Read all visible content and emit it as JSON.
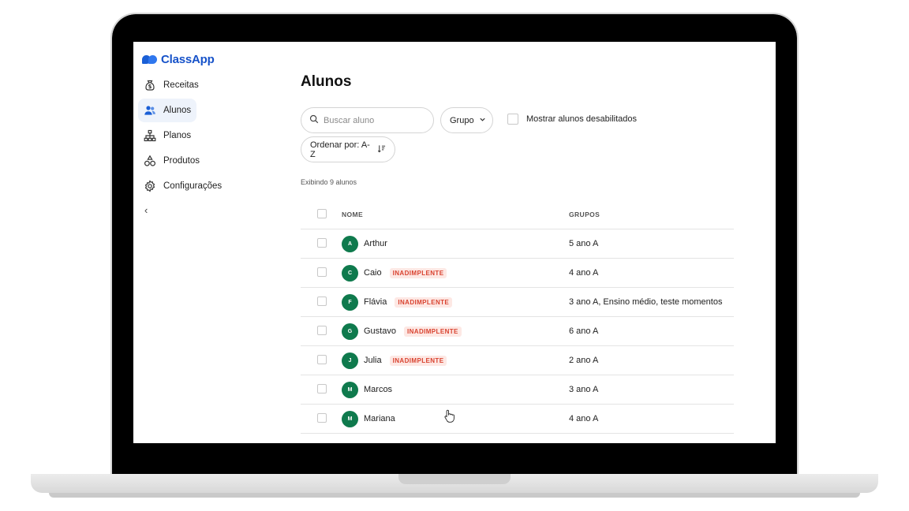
{
  "app": {
    "name": "ClassApp"
  },
  "sidebar": {
    "items": [
      {
        "label": "Receitas",
        "icon": "money-bag-icon",
        "active": false
      },
      {
        "label": "Alunos",
        "icon": "users-icon",
        "active": true
      },
      {
        "label": "Planos",
        "icon": "hierarchy-icon",
        "active": false
      },
      {
        "label": "Produtos",
        "icon": "shapes-icon",
        "active": false
      },
      {
        "label": "Configurações",
        "icon": "gear-icon",
        "active": false
      }
    ],
    "collapse_icon": "chevron-left-icon"
  },
  "page": {
    "title": "Alunos",
    "search_placeholder": "Buscar aluno",
    "group_filter": "Grupo",
    "show_disabled_label": "Mostrar alunos desabilitados",
    "sort_label": "Ordenar por: A-Z",
    "count_text": "Exibindo 9 alunos"
  },
  "table": {
    "headers": {
      "name": "NOME",
      "groups": "GRUPOS"
    },
    "rows": [
      {
        "initial": "A",
        "name": "Arthur",
        "badge": "",
        "groups": "5 ano A"
      },
      {
        "initial": "C",
        "name": "Caio",
        "badge": "INADIMPLENTE",
        "groups": "4 ano A"
      },
      {
        "initial": "F",
        "name": "Flávia",
        "badge": "INADIMPLENTE",
        "groups": "3 ano A, Ensino médio, teste momentos"
      },
      {
        "initial": "G",
        "name": "Gustavo",
        "badge": "INADIMPLENTE",
        "groups": "6 ano A"
      },
      {
        "initial": "J",
        "name": "Julia",
        "badge": "INADIMPLENTE",
        "groups": "2 ano A"
      },
      {
        "initial": "M",
        "name": "Marcos",
        "badge": "",
        "groups": "3 ano A"
      },
      {
        "initial": "M",
        "name": "Mariana",
        "badge": "",
        "groups": "4 ano A"
      }
    ]
  },
  "colors": {
    "brand": "#1652c9",
    "avatar": "#0f7a4d",
    "badge_text": "#d9422f",
    "badge_bg": "#fde8e4"
  }
}
